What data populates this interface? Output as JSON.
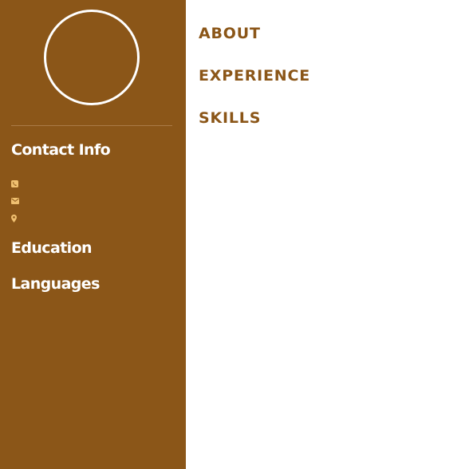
{
  "sidebar": {
    "contact_heading": "Contact Info",
    "education_heading": "Education",
    "languages_heading": "Languages",
    "contact_icons": [
      "phone-icon",
      "envelope-icon",
      "map-marker-icon"
    ]
  },
  "main": {
    "sections": [
      "ABOUT",
      "EXPERIENCE",
      "SKILLS"
    ]
  },
  "colors": {
    "sidebar_bg": "#8b5618",
    "accent": "#8b5618",
    "icon": "#f0c070",
    "text_light": "#ffffff"
  }
}
